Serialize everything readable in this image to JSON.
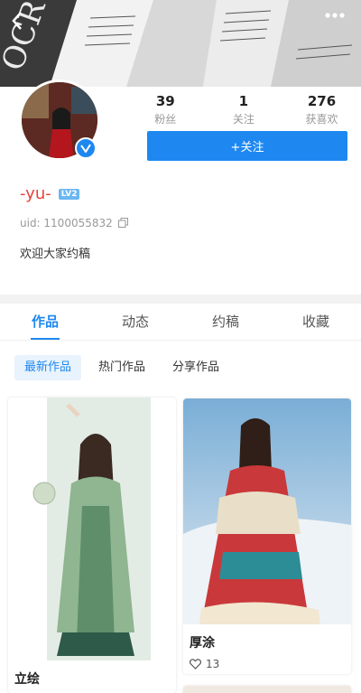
{
  "header": {
    "back_icon": "chevron-left-icon",
    "more_icon": "more-dots-icon"
  },
  "profile": {
    "stats": [
      {
        "value": "39",
        "label": "粉丝"
      },
      {
        "value": "1",
        "label": "关注"
      },
      {
        "value": "276",
        "label": "获喜欢"
      }
    ],
    "follow_label": "+关注",
    "username": "-yu-",
    "level_badge": "LV2",
    "uid": "uid: 1100055832",
    "bio": "欢迎大家约稿",
    "verified_icon": "verified-v-icon"
  },
  "tabs": [
    "作品",
    "动态",
    "约稿",
    "收藏"
  ],
  "active_tab": 0,
  "subtabs": [
    "最新作品",
    "热门作品",
    "分享作品"
  ],
  "active_subtab": 0,
  "cards": [
    {
      "title": "立绘"
    },
    {
      "title": "厚涂",
      "likes": "13"
    }
  ],
  "colors": {
    "accent": "#1e88f0",
    "username": "#e8433a",
    "muted": "#999999"
  }
}
